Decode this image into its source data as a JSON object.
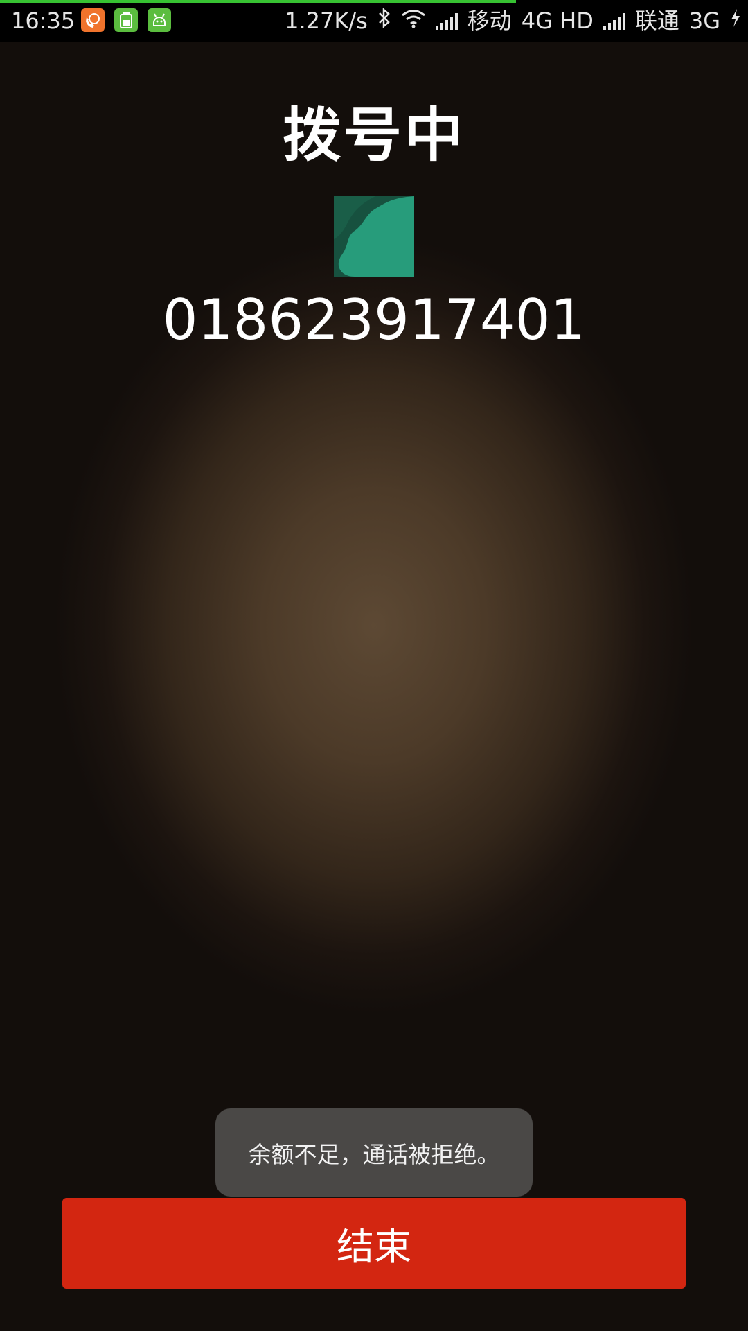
{
  "status_bar": {
    "time": "16:35",
    "net_speed": "1.27K/s",
    "carrier1": "移动",
    "carrier1_network": "4G HD",
    "carrier2": "联通",
    "carrier2_network": "3G",
    "download_progress": 0.69,
    "progress_color": "#37c232",
    "icons": [
      "phone-app-notification-icon",
      "battery-app-notification-icon",
      "android-notification-icon",
      "bluetooth-icon",
      "wifi-icon",
      "signal-icon",
      "charging-icon"
    ]
  },
  "call": {
    "status": "拨号中",
    "number": "018623917401"
  },
  "toast": {
    "message": "余额不足，通话被拒绝。"
  },
  "controls": {
    "end_label": "结束",
    "end_color": "#d32611"
  }
}
